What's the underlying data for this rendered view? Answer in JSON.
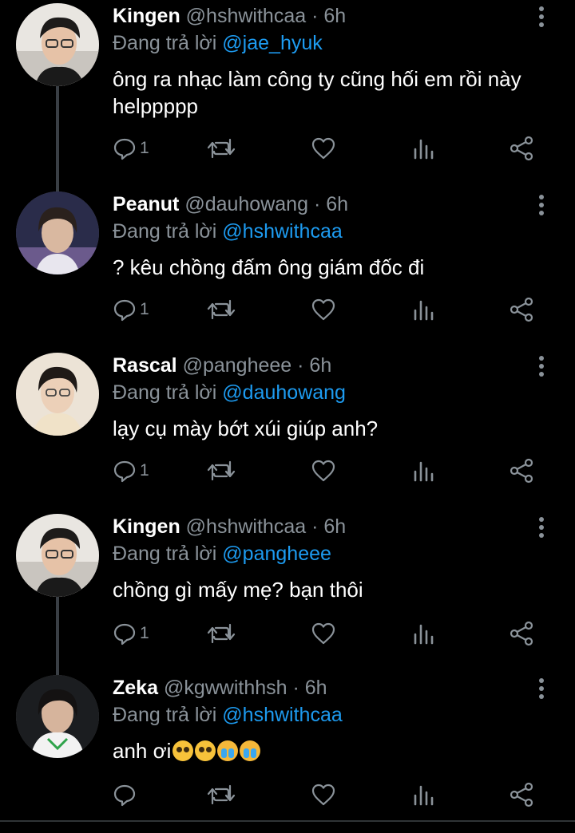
{
  "tweets": [
    {
      "name": "Kingen",
      "handle": "@hshwithcaa",
      "time": "6h",
      "reply_prefix": "Đang trả lời",
      "reply_to": "@jae_hyuk",
      "text": "ông ra nhạc làm công ty cũng hối em rồi này helppppp",
      "reply_count": "1",
      "avatar_icon": "kingen-avatar"
    },
    {
      "name": "Peanut",
      "handle": "@dauhowang",
      "time": "6h",
      "reply_prefix": "Đang trả lời",
      "reply_to": "@hshwithcaa",
      "text": "? kêu chồng đấm ông giám đốc đi",
      "reply_count": "1",
      "avatar_icon": "peanut-avatar"
    },
    {
      "name": "Rascal",
      "handle": "@pangheee",
      "time": "6h",
      "reply_prefix": "Đang trả lời",
      "reply_to": "@dauhowang",
      "text": "lạy cụ mày bớt xúi giúp anh?",
      "reply_count": "1",
      "avatar_icon": "rascal-avatar"
    },
    {
      "name": "Kingen",
      "handle": "@hshwithcaa",
      "time": "6h",
      "reply_prefix": "Đang trả lời",
      "reply_to": "@pangheee",
      "text": "chồng gì mấy mẹ? bạn thôi",
      "reply_count": "1",
      "avatar_icon": "kingen-avatar"
    },
    {
      "name": "Zeka",
      "handle": "@kgwwithhsh",
      "time": "6h",
      "reply_prefix": "Đang trả lời",
      "reply_to": "@hshwithcaa",
      "text": "anh ơi",
      "emojis": [
        "pleading-face",
        "pleading-face",
        "loudly-crying-face",
        "loudly-crying-face"
      ],
      "reply_count": "",
      "avatar_icon": "zeka-avatar"
    }
  ],
  "separator": "·",
  "colors": {
    "background": "#000000",
    "secondary_text": "#8a9299",
    "mention": "#1d9bf0",
    "thread_line": "#3a3f45"
  },
  "icons": [
    "reply-icon",
    "retweet-icon",
    "like-icon",
    "analytics-icon",
    "share-icon",
    "more-icon"
  ]
}
